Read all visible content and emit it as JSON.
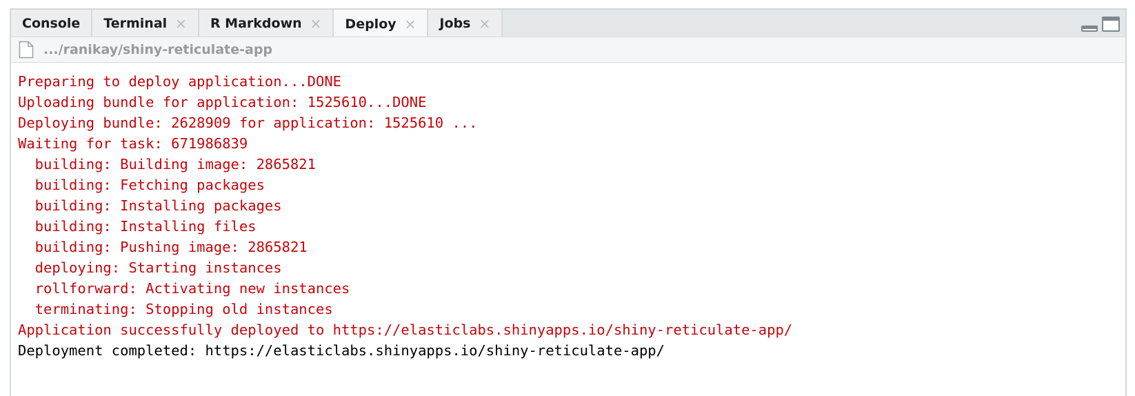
{
  "tabs": [
    {
      "label": "Console",
      "closable": false,
      "active": false
    },
    {
      "label": "Terminal",
      "closable": true,
      "active": false
    },
    {
      "label": "R Markdown",
      "closable": true,
      "active": false
    },
    {
      "label": "Deploy",
      "closable": true,
      "active": true
    },
    {
      "label": "Jobs",
      "closable": true,
      "active": false
    }
  ],
  "close_glyph": "×",
  "path": {
    "text": ".../ranikay/shiny-reticulate-app",
    "icon": "file-icon"
  },
  "window_controls": {
    "minimize_icon": "minimize-icon",
    "maximize_icon": "maximize-icon"
  },
  "colors": {
    "output_red": "#c5060b",
    "output_black": "#000000"
  },
  "console_lines": [
    {
      "text": "Preparing to deploy application...DONE",
      "color": "red"
    },
    {
      "text": "Uploading bundle for application: 1525610...DONE",
      "color": "red"
    },
    {
      "text": "Deploying bundle: 2628909 for application: 1525610 ...",
      "color": "red"
    },
    {
      "text": "Waiting for task: 671986839",
      "color": "red"
    },
    {
      "text": "  building: Building image: 2865821",
      "color": "red"
    },
    {
      "text": "  building: Fetching packages",
      "color": "red"
    },
    {
      "text": "  building: Installing packages",
      "color": "red"
    },
    {
      "text": "  building: Installing files",
      "color": "red"
    },
    {
      "text": "  building: Pushing image: 2865821",
      "color": "red"
    },
    {
      "text": "  deploying: Starting instances",
      "color": "red"
    },
    {
      "text": "  rollforward: Activating new instances",
      "color": "red"
    },
    {
      "text": "  terminating: Stopping old instances",
      "color": "red"
    },
    {
      "text": "Application successfully deployed to https://elasticlabs.shinyapps.io/shiny-reticulate-app/",
      "color": "red"
    },
    {
      "text": "Deployment completed: https://elasticlabs.shinyapps.io/shiny-reticulate-app/",
      "color": "black"
    }
  ]
}
